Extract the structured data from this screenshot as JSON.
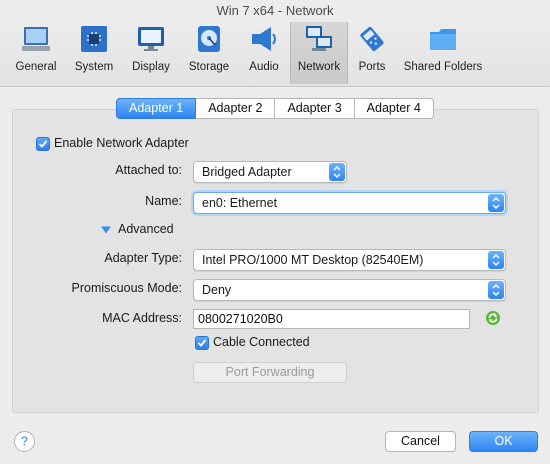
{
  "window": {
    "title": "Win 7 x64 - Network"
  },
  "toolbar": {
    "items": [
      {
        "label": "General",
        "icon": "general-icon"
      },
      {
        "label": "System",
        "icon": "system-icon"
      },
      {
        "label": "Display",
        "icon": "display-icon"
      },
      {
        "label": "Storage",
        "icon": "storage-icon"
      },
      {
        "label": "Audio",
        "icon": "audio-icon"
      },
      {
        "label": "Network",
        "icon": "network-icon",
        "selected": true
      },
      {
        "label": "Ports",
        "icon": "ports-icon"
      },
      {
        "label": "Shared Folders",
        "icon": "shared-folders-icon"
      }
    ]
  },
  "tabs": [
    {
      "label": "Adapter 1",
      "active": true
    },
    {
      "label": "Adapter 2"
    },
    {
      "label": "Adapter 3"
    },
    {
      "label": "Adapter 4"
    }
  ],
  "form": {
    "enable_label": "Enable Network Adapter",
    "enable_checked": true,
    "attached_label": "Attached to:",
    "attached_value": "Bridged Adapter",
    "name_label": "Name:",
    "name_value": "en0: Ethernet",
    "advanced_label": "Advanced",
    "adapter_type_label": "Adapter Type:",
    "adapter_type_value": "Intel PRO/1000 MT Desktop (82540EM)",
    "promiscuous_label": "Promiscuous Mode:",
    "promiscuous_value": "Deny",
    "mac_label": "MAC Address:",
    "mac_value": "0800271020B0",
    "cable_label": "Cable Connected",
    "cable_checked": true,
    "port_forwarding_label": "Port Forwarding"
  },
  "footer": {
    "help_label": "?",
    "cancel_label": "Cancel",
    "ok_label": "OK"
  },
  "colors": {
    "accent": "#2f84f0",
    "panel": "#e3e3e3",
    "window": "#ececec"
  }
}
